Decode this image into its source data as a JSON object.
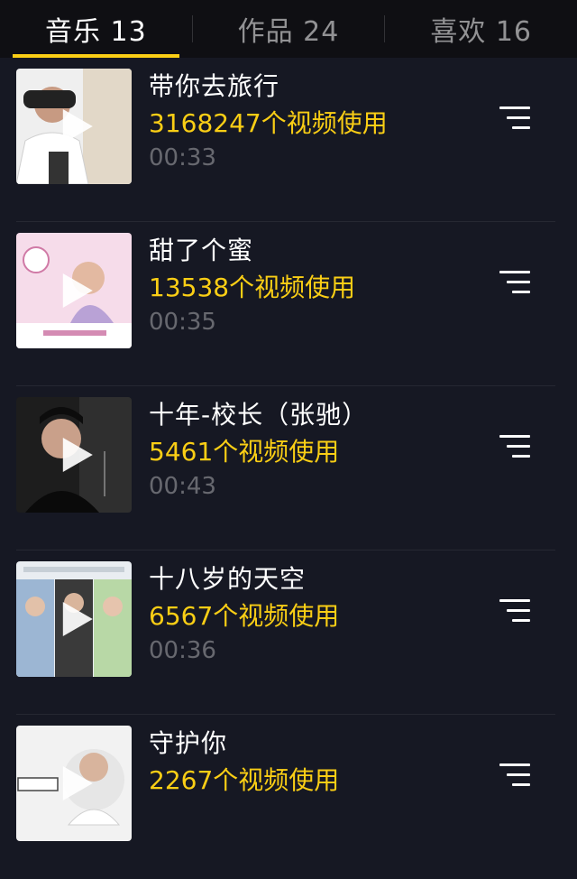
{
  "tabs": [
    {
      "label": "音乐 13",
      "active": true
    },
    {
      "label": "作品 24",
      "active": false
    },
    {
      "label": "喜欢 16",
      "active": false
    }
  ],
  "songs": [
    {
      "title": "带你去旅行",
      "uses": "3168247个视频使用",
      "duration": "00:33",
      "cover_colors": [
        "#f4f4f4",
        "#d9c9b3"
      ]
    },
    {
      "title": "甜了个蜜",
      "uses": "13538个视频使用",
      "duration": "00:35",
      "cover_colors": [
        "#f7d6e8",
        "#c9a6d8"
      ]
    },
    {
      "title": "十年-校长（张驰）",
      "uses": "5461个视频使用",
      "duration": "00:43",
      "cover_colors": [
        "#2a2a2a",
        "#101010"
      ]
    },
    {
      "title": "十八岁的天空",
      "uses": "6567个视频使用",
      "duration": "00:36",
      "cover_colors": [
        "#dfe7ee",
        "#7fa9c9"
      ]
    },
    {
      "title": "守护你",
      "uses": "2267个视频使用",
      "duration": "",
      "cover_colors": [
        "#ececec",
        "#d4d4d4"
      ]
    }
  ],
  "colors": {
    "accent": "#face15",
    "background": "#161823"
  },
  "icons": {
    "play": "play-icon",
    "menu": "list-menu-icon"
  }
}
